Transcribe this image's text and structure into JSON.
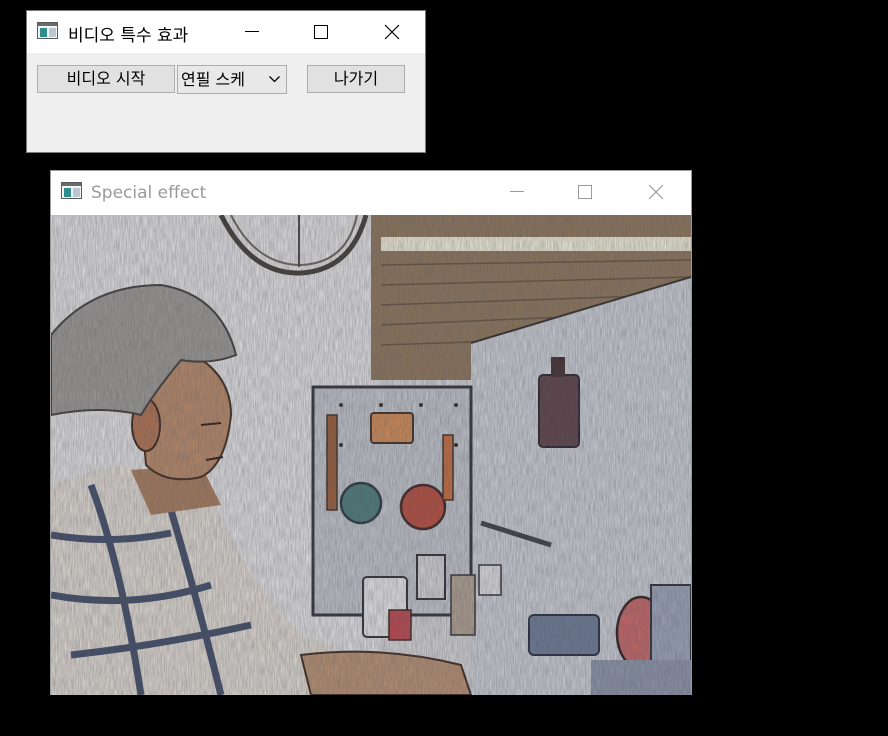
{
  "control_window": {
    "title": "비디오 특수 효과",
    "start_button": "비디오 시작",
    "effect_combo": "연필 스케",
    "exit_button": "나가기"
  },
  "video_window": {
    "title": "Special effect"
  },
  "icons": {
    "app": "app-window-icon",
    "minimize": "minimize-icon",
    "maximize": "maximize-icon",
    "close": "close-icon",
    "dropdown": "chevron-down-icon"
  }
}
